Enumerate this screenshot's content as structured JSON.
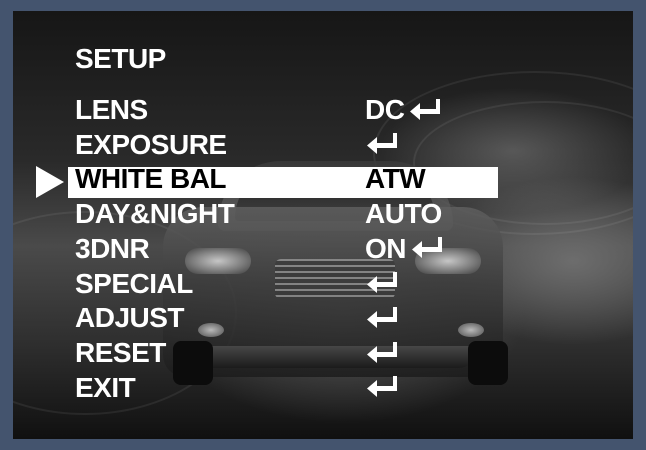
{
  "menu": {
    "title": "SETUP",
    "selected_index": 2,
    "items": [
      {
        "label": "LENS",
        "value": "DC",
        "enter_icon": true
      },
      {
        "label": "EXPOSURE",
        "value": "",
        "enter_icon": true
      },
      {
        "label": "WHITE BAL",
        "value": "ATW",
        "enter_icon": false
      },
      {
        "label": "DAY&NIGHT",
        "value": "AUTO",
        "enter_icon": false
      },
      {
        "label": "3DNR",
        "value": "ON",
        "enter_icon": true
      },
      {
        "label": "SPECIAL",
        "value": "",
        "enter_icon": true
      },
      {
        "label": "ADJUST",
        "value": "",
        "enter_icon": true
      },
      {
        "label": "RESET",
        "value": "",
        "enter_icon": true
      },
      {
        "label": "EXIT",
        "value": "",
        "enter_icon": true
      }
    ]
  },
  "icons": {
    "cursor": "right-triangle-cursor-icon",
    "enter": "enter-return-arrow-icon"
  },
  "colors": {
    "frame": "#44546e",
    "text": "#ffffff",
    "highlight": "#ffffff",
    "highlight_text": "#000000"
  }
}
